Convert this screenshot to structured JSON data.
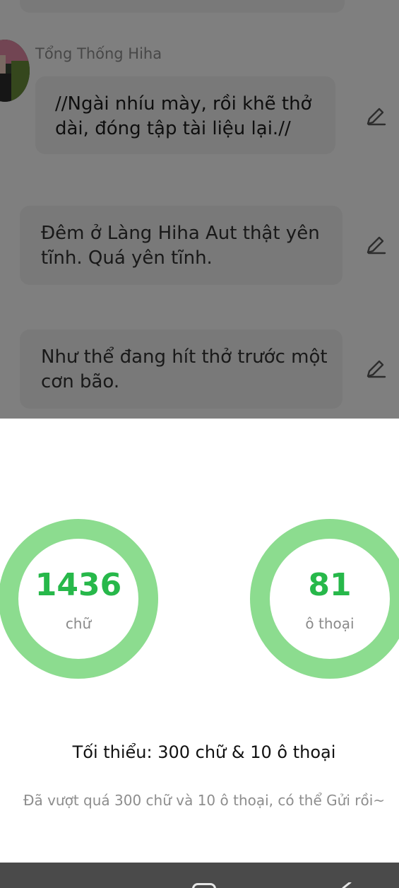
{
  "chat": {
    "speaker_name": "Tổng Thống Hiha",
    "messages": [
      {
        "text": "//Ngài nhíu mày, rồi khẽ thở dài, đóng tập tài liệu lại.//"
      },
      {
        "text": "Đêm ở Làng Hiha Aut thật yên tĩnh. Quá yên tĩnh."
      },
      {
        "text": "Như thể đang hít thở trước một cơn bão."
      }
    ],
    "edit_icon": "pencil-icon"
  },
  "stats": {
    "words": {
      "value": "1436",
      "unit": "chữ"
    },
    "dialogs": {
      "value": "81",
      "unit": "ô thoại"
    },
    "ring_color": "#8cdc8f",
    "number_color": "#27b84a"
  },
  "requirement_text": "Tối thiểu: 300 chữ & 10 ô thoại",
  "hint_text": "Đã vượt quá 300 chữ và 10 ô thoại, có thể Gửi rồi~",
  "navbar": {
    "recents_icon": "recents-icon",
    "home_icon": "home-icon",
    "back_icon": "back-icon"
  }
}
